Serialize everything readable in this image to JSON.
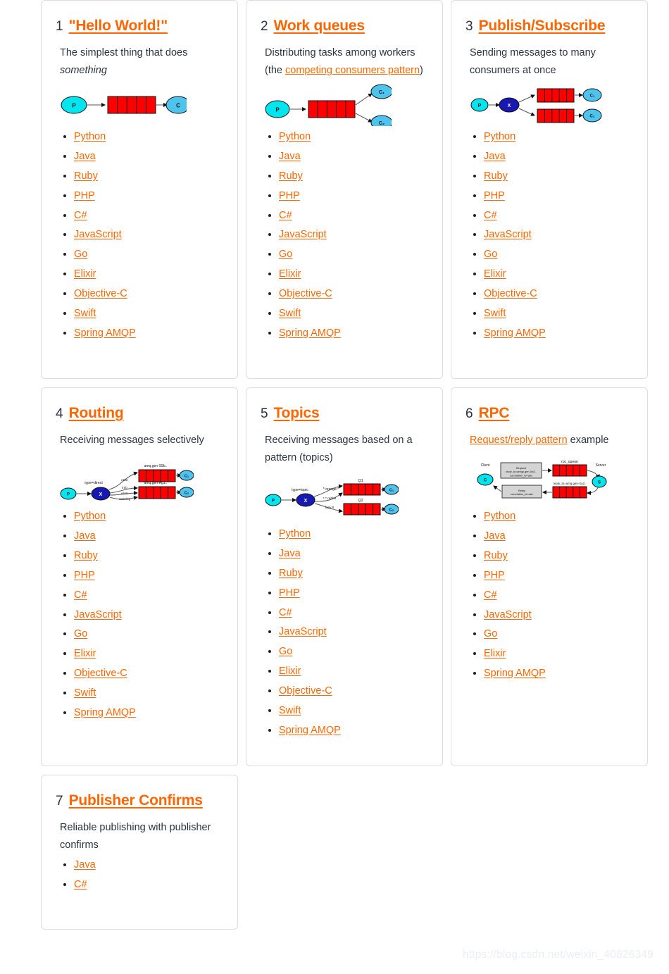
{
  "watermark": "https://blog.csdn.net/weixin_40826349",
  "languages": [
    "Python",
    "Java",
    "Ruby",
    "PHP",
    "C#",
    "JavaScript",
    "Go",
    "Elixir",
    "Objective-C",
    "Swift",
    "Spring AMQP"
  ],
  "colors": {
    "link": "#ff6600",
    "text": "#2b3440",
    "border": "#dcdde1",
    "queue_red": "#ff0000",
    "producer_cyan": "#00e5ee",
    "consumer_blue": "#4ec3ee",
    "exchange_blue": "#1818b2",
    "box_gray": "#d4d4d4"
  },
  "cards": [
    {
      "num": "1",
      "title": "\"Hello World!\"",
      "desc_parts": [
        {
          "text": "The simplest thing that does ",
          "type": "plain"
        },
        {
          "text": "something",
          "type": "italic"
        }
      ],
      "diagram": {
        "name": "hello-world-diagram",
        "producer": "P",
        "consumer": "C",
        "queues": 1
      },
      "languages": [
        "Python",
        "Java",
        "Ruby",
        "PHP",
        "C#",
        "JavaScript",
        "Go",
        "Elixir",
        "Objective-C",
        "Swift",
        "Spring AMQP"
      ]
    },
    {
      "num": "2",
      "title": "Work queues",
      "desc_parts": [
        {
          "text": "Distributing tasks among workers (the ",
          "type": "plain"
        },
        {
          "text": "competing consumers pattern",
          "type": "link"
        },
        {
          "text": ")",
          "type": "plain"
        }
      ],
      "diagram": {
        "name": "work-queues-diagram",
        "producer": "P",
        "consumers": [
          "C₁",
          "C₂"
        ]
      },
      "languages": [
        "Python",
        "Java",
        "Ruby",
        "PHP",
        "C#",
        "JavaScript",
        "Go",
        "Elixir",
        "Objective-C",
        "Swift",
        "Spring AMQP"
      ]
    },
    {
      "num": "3",
      "title": "Publish/Subscribe",
      "desc_parts": [
        {
          "text": "Sending messages to many consumers at once",
          "type": "plain"
        }
      ],
      "diagram": {
        "name": "publish-subscribe-diagram",
        "producer": "P",
        "exchange": "X",
        "consumers": [
          "C₁",
          "C₂"
        ]
      },
      "languages": [
        "Python",
        "Java",
        "Ruby",
        "PHP",
        "C#",
        "JavaScript",
        "Go",
        "Elixir",
        "Objective-C",
        "Swift",
        "Spring AMQP"
      ]
    },
    {
      "num": "4",
      "title": "Routing",
      "desc_parts": [
        {
          "text": "Receiving messages selectively",
          "type": "plain"
        }
      ],
      "diagram": {
        "name": "routing-diagram",
        "producer": "P",
        "exchange": "X",
        "exchange_type": "type=direct",
        "bindings": [
          "error",
          "info",
          "error",
          "warning"
        ],
        "queue_labels": [
          "amq.gen-S9b..",
          "amq.gen-Ag1.."
        ],
        "consumers": [
          "C₁",
          "C₂"
        ]
      },
      "languages": [
        "Python",
        "Java",
        "Ruby",
        "PHP",
        "C#",
        "JavaScript",
        "Go",
        "Elixir",
        "Objective-C",
        "Swift",
        "Spring AMQP"
      ]
    },
    {
      "num": "5",
      "title": "Topics",
      "desc_parts": [
        {
          "text": "Receiving messages based on a pattern (topics)",
          "type": "plain"
        }
      ],
      "diagram": {
        "name": "topics-diagram",
        "producer": "P",
        "exchange": "X",
        "exchange_type": "type=topic",
        "bindings": [
          "*.orange.*",
          "*.*.rabbit",
          "lazy.#"
        ],
        "queue_labels": [
          "Q1",
          "Q2"
        ],
        "consumers": [
          "C₁",
          "C₂"
        ]
      },
      "languages": [
        "Python",
        "Java",
        "Ruby",
        "PHP",
        "C#",
        "JavaScript",
        "Go",
        "Elixir",
        "Objective-C",
        "Swift",
        "Spring AMQP"
      ]
    },
    {
      "num": "6",
      "title": "RPC",
      "desc_parts": [
        {
          "text": "Request/reply pattern",
          "type": "link"
        },
        {
          "text": " example",
          "type": "plain"
        }
      ],
      "diagram": {
        "name": "rpc-diagram",
        "client_label": "Client",
        "client": "C",
        "server_label": "Server",
        "server": "S",
        "request_box": [
          "Request",
          "reply_to=amqp.gen-Xa2..",
          "correlation_id=abc"
        ],
        "reply_box": [
          "Reply",
          "correlation_id=abc"
        ],
        "queue_labels": [
          "rpc_queue",
          "reply_to=amq.gen-Xa2.."
        ]
      },
      "languages": [
        "Python",
        "Java",
        "Ruby",
        "PHP",
        "C#",
        "JavaScript",
        "Go",
        "Elixir",
        "Spring AMQP"
      ]
    },
    {
      "num": "7",
      "title": "Publisher Confirms",
      "desc_parts": [
        {
          "text": "Reliable publishing with publisher confirms",
          "type": "plain"
        }
      ],
      "diagram": null,
      "languages": [
        "Java",
        "C#"
      ]
    }
  ]
}
